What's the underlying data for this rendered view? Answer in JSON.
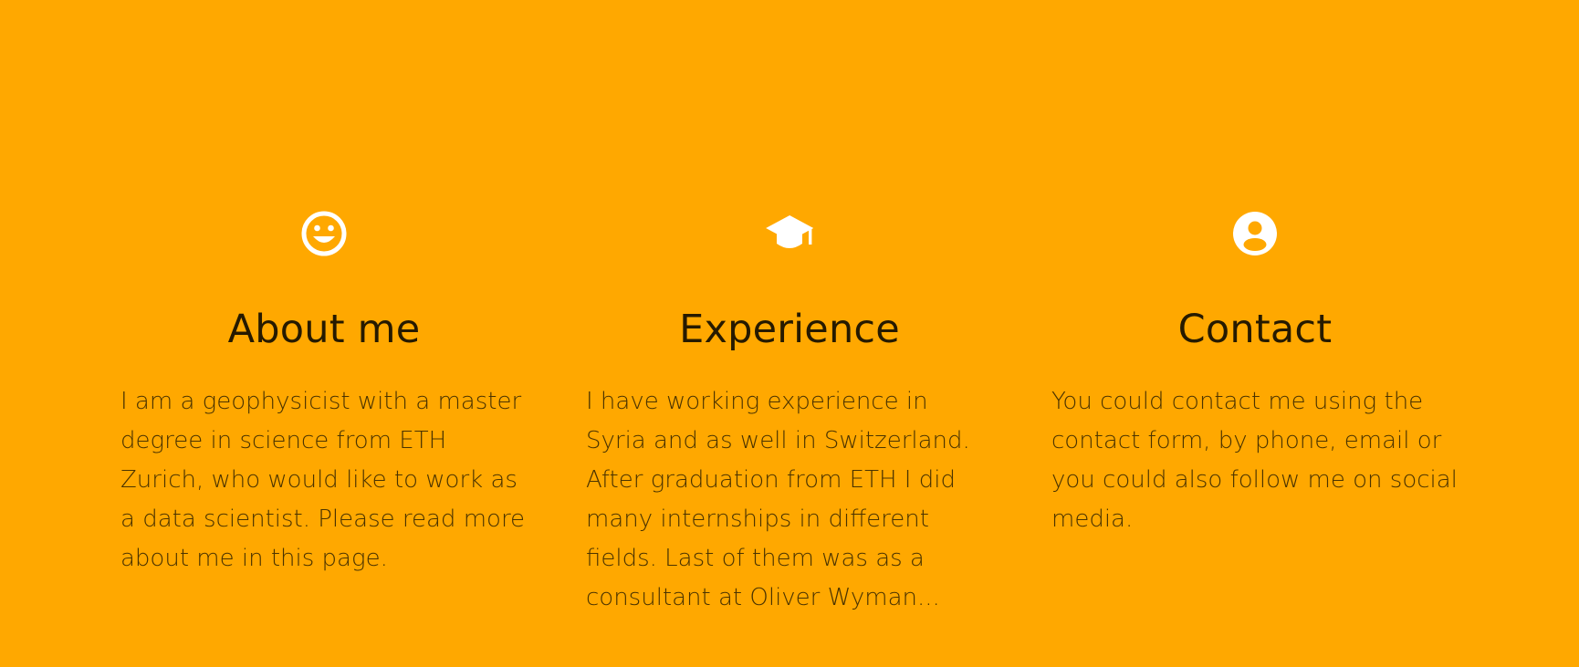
{
  "colors": {
    "background": "#FFA800",
    "icon": "#FFFFFF",
    "heading": "#261A00",
    "body_text": "#4A3300"
  },
  "features": [
    {
      "icon": "smiley-face-icon",
      "title": "About me",
      "text": "I am a geophysicist with a master degree in science from ETH Zurich, who would like to work as a data scientist. Please read more about me in this page."
    },
    {
      "icon": "graduation-cap-icon",
      "title": "Experience",
      "text": "I have working experience in Syria and as well in Switzerland. After graduation from ETH I did many internships in different fields. Last of them was as a consultant at Oliver Wyman..."
    },
    {
      "icon": "user-circle-icon",
      "title": "Contact",
      "text": "You could contact me using the contact form, by phone, email or you could also follow me on social media."
    }
  ]
}
